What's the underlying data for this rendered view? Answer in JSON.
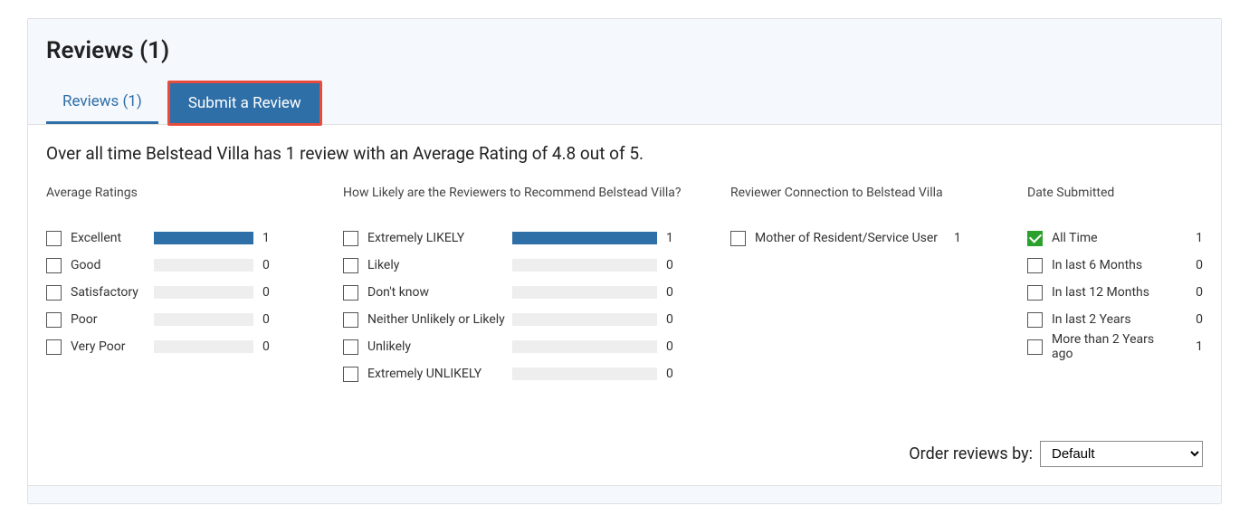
{
  "header": {
    "title": "Reviews (1)"
  },
  "tabs": {
    "reviews_label": "Reviews (1)",
    "submit_label": "Submit a Review"
  },
  "summary": "Over all time Belstead Villa has 1 review with an Average Rating of 4.8 out of 5.",
  "columns": {
    "ratings_heading": "Average Ratings",
    "recommend_heading": "How Likely are the Reviewers to Recommend Belstead Villa?",
    "connection_heading": "Reviewer Connection to Belstead Villa",
    "date_heading": "Date Submitted"
  },
  "ratings": [
    {
      "label": "Excellent",
      "count": "1",
      "fill": 100
    },
    {
      "label": "Good",
      "count": "0",
      "fill": 0
    },
    {
      "label": "Satisfactory",
      "count": "0",
      "fill": 0
    },
    {
      "label": "Poor",
      "count": "0",
      "fill": 0
    },
    {
      "label": "Very Poor",
      "count": "0",
      "fill": 0
    }
  ],
  "recommend": [
    {
      "label": "Extremely LIKELY",
      "count": "1",
      "fill": 100
    },
    {
      "label": "Likely",
      "count": "0",
      "fill": 0
    },
    {
      "label": "Don't know",
      "count": "0",
      "fill": 0
    },
    {
      "label": "Neither Unlikely or Likely",
      "count": "0",
      "fill": 0
    },
    {
      "label": "Unlikely",
      "count": "0",
      "fill": 0
    },
    {
      "label": "Extremely UNLIKELY",
      "count": "0",
      "fill": 0
    }
  ],
  "connection": [
    {
      "label": "Mother of Resident/Service User",
      "count": "1"
    }
  ],
  "dates": [
    {
      "label": "All Time",
      "count": "1",
      "checked": true
    },
    {
      "label": "In last 6 Months",
      "count": "0",
      "checked": false
    },
    {
      "label": "In last 12 Months",
      "count": "0",
      "checked": false
    },
    {
      "label": "In last 2 Years",
      "count": "0",
      "checked": false
    },
    {
      "label": "More than 2 Years ago",
      "count": "1",
      "checked": false
    }
  ],
  "order": {
    "label": "Order reviews by:",
    "selected": "Default"
  },
  "chart_data": [
    {
      "type": "bar",
      "title": "Average Ratings",
      "categories": [
        "Excellent",
        "Good",
        "Satisfactory",
        "Poor",
        "Very Poor"
      ],
      "values": [
        1,
        0,
        0,
        0,
        0
      ]
    },
    {
      "type": "bar",
      "title": "How Likely are the Reviewers to Recommend Belstead Villa?",
      "categories": [
        "Extremely LIKELY",
        "Likely",
        "Don't know",
        "Neither Unlikely or Likely",
        "Unlikely",
        "Extremely UNLIKELY"
      ],
      "values": [
        1,
        0,
        0,
        0,
        0,
        0
      ]
    }
  ]
}
